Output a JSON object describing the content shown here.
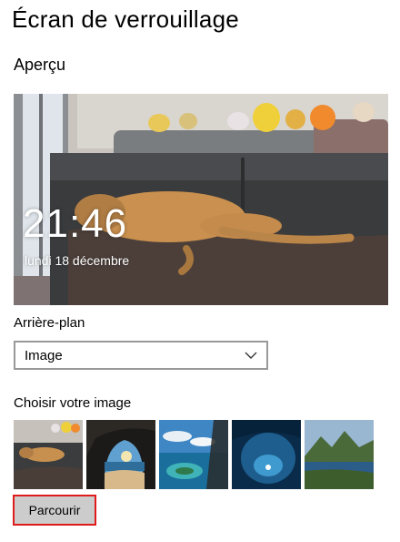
{
  "page": {
    "title": "Écran de verrouillage"
  },
  "preview": {
    "section_title": "Aperçu",
    "time": "21:46",
    "date": "lundi 18 décembre"
  },
  "background": {
    "label": "Arrière-plan",
    "selected": "Image",
    "icon": "chevron-down-icon"
  },
  "images": {
    "label": "Choisir votre image",
    "thumbnails": [
      "dog-sofa",
      "beach-cave",
      "tropical-island",
      "ice-cave",
      "mountain-lake"
    ],
    "browse_label": "Parcourir"
  },
  "colors": {
    "accent_border": "#e01b1b",
    "button_bg": "#cccccc",
    "select_border": "#999999"
  }
}
